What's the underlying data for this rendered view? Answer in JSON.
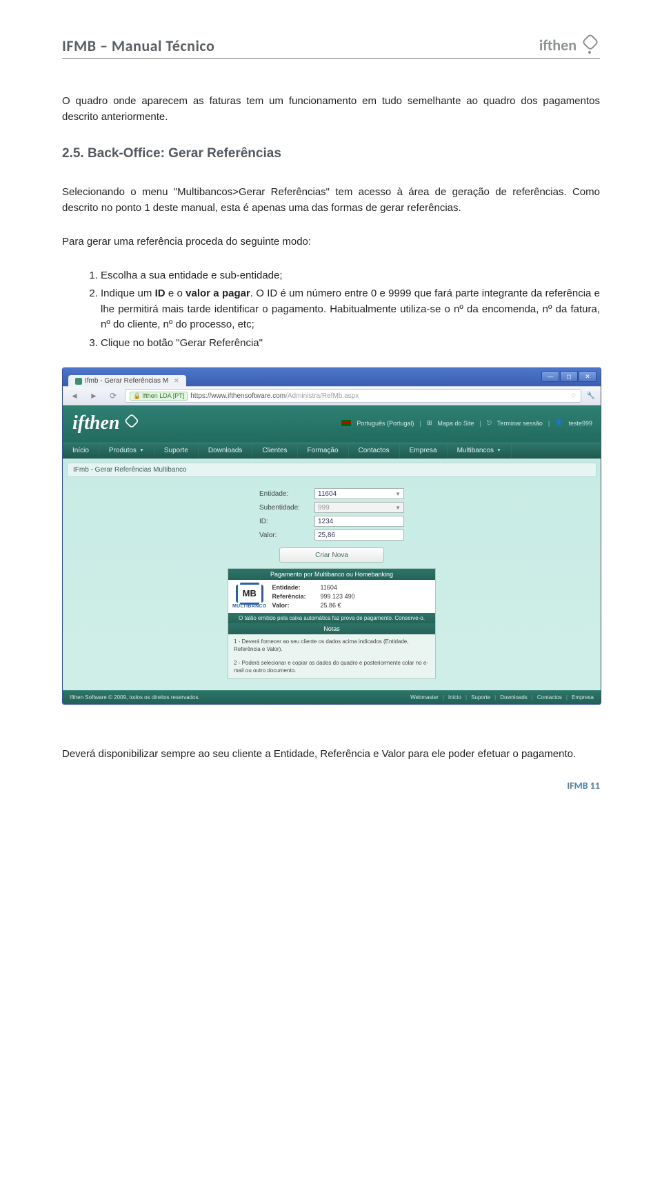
{
  "header": {
    "title": "IFMB – Manual Técnico",
    "logo_text": "ifthen"
  },
  "para1": "O quadro onde aparecem as faturas tem um funcionamento em tudo semelhante ao quadro dos pagamentos descrito anteriormente.",
  "section": {
    "number": "2.5.",
    "title": "Back-Office: Gerar Referências"
  },
  "para2": "Selecionando o menu \"Multibancos>Gerar Referências\" tem acesso à área de geração de referências. Como descrito no ponto 1 deste manual, esta é apenas uma das formas de gerar referências.",
  "para3": "Para gerar uma referência proceda do seguinte modo:",
  "steps": {
    "s1": "Escolha a sua entidade e sub-entidade;",
    "s2a": "Indique um ",
    "s2b": "ID",
    "s2c": " e o ",
    "s2d": "valor a pagar",
    "s2e": ". O ID é um número entre 0 e 9999 que fará parte integrante da referência e lhe permitirá mais tarde identificar o pagamento. Habitualmente utiliza-se o nº da encomenda, nº da fatura, nº do cliente, nº do processo, etc;",
    "s3": "Clique no botão \"Gerar Referência\""
  },
  "browser": {
    "tab_title": "Ifmb - Gerar Referências M",
    "ssl_chip": "Ifthen LDA [PT]",
    "url_host": "https://www.ifthensoftware.com",
    "url_path": "/Administra/RefMb.aspx",
    "app_logo": "ifthen",
    "util": {
      "lang": "Português (Portugal)",
      "map": "Mapa do Site",
      "logout": "Terminar sessão",
      "user": "teste999"
    },
    "menu": [
      "Início",
      "Produtos",
      "Suporte",
      "Downloads",
      "Clientes",
      "Formação",
      "Contactos",
      "Empresa",
      "Multibancos"
    ],
    "breadcrumb": "IFmb - Gerar Referências Multibanco",
    "form": {
      "entidade_lbl": "Entidade:",
      "entidade_val": "11604",
      "subentidade_lbl": "Subentidade:",
      "subentidade_val": "999",
      "id_lbl": "ID:",
      "id_val": "1234",
      "valor_lbl": "Valor:",
      "valor_val": "25,86",
      "button": "Criar Nova"
    },
    "panel": {
      "header": "Pagamento por Multibanco ou Homebanking",
      "mb_mark": "MB",
      "mb_label": "MULTIBANCO",
      "ent_lbl": "Entidade:",
      "ent_val": "11604",
      "ref_lbl": "Referência:",
      "ref_val": "999 123 490",
      "val_lbl": "Valor:",
      "val_val": "25.86 €",
      "talao": "O talão emitido pela caixa automática faz prova de pagamento. Conserve-o.",
      "notes_hdr": "Notas",
      "note1": "1 - Deverá fornecer ao seu cliente os dados acima indicados (Entidade, Referência e Valor).",
      "note2": "2 - Poderá selecionar e copiar os dados do quadro e posteriormente colar no e-mail ou outro documento."
    },
    "footer": {
      "copy": "Ifthen Software © 2009, todos os direitos reservados.",
      "links": [
        "Webmaster",
        "Início",
        "Suporte",
        "Downloads",
        "Contactos",
        "Empresa"
      ]
    }
  },
  "para4": "Deverá disponibilizar sempre ao seu cliente a Entidade, Referência e Valor para ele poder efetuar o pagamento.",
  "page_number": "IFMB 11"
}
